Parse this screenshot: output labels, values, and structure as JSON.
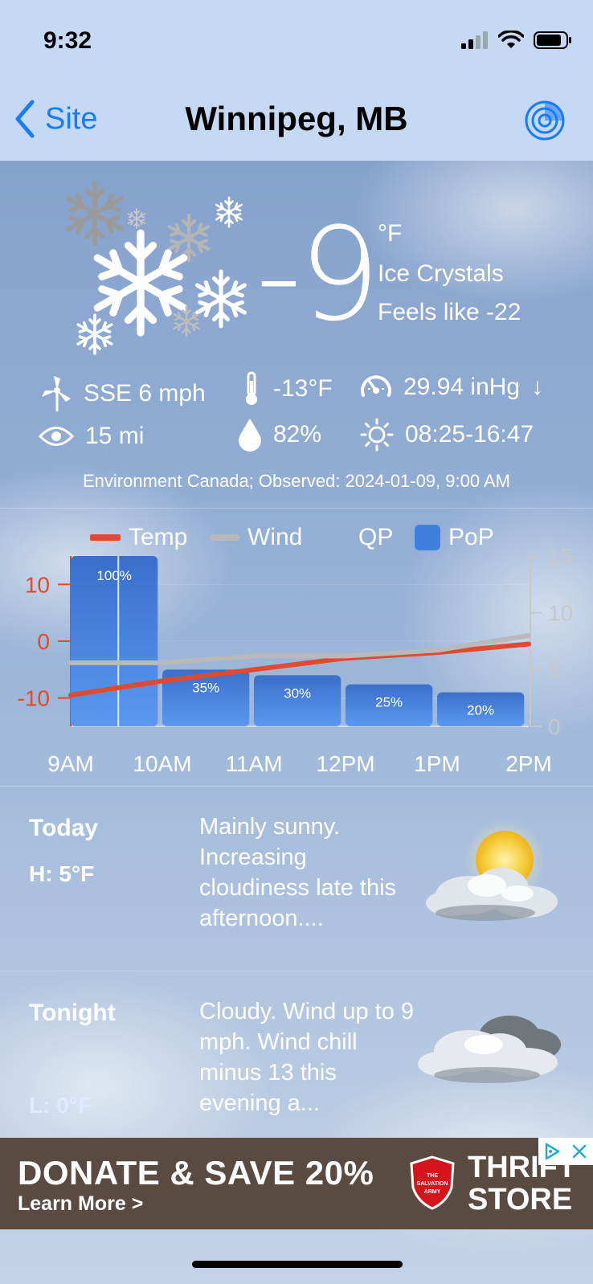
{
  "status_bar": {
    "time": "9:32"
  },
  "nav": {
    "back_label": "Site",
    "title": "Winnipeg, MB"
  },
  "current": {
    "temperature": "-9",
    "unit": "°F",
    "condition": "Ice Crystals",
    "feels_like": "Feels like -22"
  },
  "stats": {
    "wind": "SSE 6 mph",
    "dewpoint": "-13°F",
    "pressure": "29.94 inHg",
    "pressure_trend": "↓",
    "visibility": "15 mi",
    "humidity": "82%",
    "sun": "08:25-16:47"
  },
  "source": "Environment Canada; Observed: 2024-01-09, 9:00 AM",
  "legend": {
    "temp": "Temp",
    "wind": "Wind",
    "qp": "QP",
    "pop": "PoP"
  },
  "colors": {
    "temp": "#e04a2f",
    "wind": "#b9b9b9",
    "pop": "#3f7fe0",
    "left_axis": "#e04a2f",
    "right_axis": "#c8c8c8"
  },
  "chart_data": {
    "type": "bar",
    "x": [
      "9AM",
      "10AM",
      "11AM",
      "12PM",
      "1PM",
      "2PM"
    ],
    "pop_bars": [
      {
        "start": 0,
        "end": 0.95,
        "value": 15,
        "label": "100%"
      },
      {
        "start": 1,
        "end": 1.95,
        "value": 5,
        "label": "35%"
      },
      {
        "start": 2,
        "end": 2.95,
        "value": 4.5,
        "label": "30%"
      },
      {
        "start": 3,
        "end": 3.95,
        "value": 3.7,
        "label": "25%"
      },
      {
        "start": 4,
        "end": 4.95,
        "value": 3,
        "label": "20%"
      }
    ],
    "series": [
      {
        "name": "Temp",
        "axis": "left",
        "x": [
          0,
          1,
          2,
          3,
          4,
          5
        ],
        "values": [
          -9.5,
          -7,
          -5,
          -3,
          -2,
          -0.5
        ]
      },
      {
        "name": "Wind",
        "axis": "right",
        "x": [
          0,
          1,
          2,
          3,
          4,
          5
        ],
        "values": [
          5.6,
          5.6,
          6.2,
          6.2,
          6.7,
          8
        ]
      }
    ],
    "left_ticks": [
      "10",
      "0",
      "-10"
    ],
    "left_ylim": [
      -15,
      15
    ],
    "right_ticks": [
      "15",
      "10",
      "5",
      "0"
    ],
    "right_ylim": [
      0,
      15
    ]
  },
  "forecast": [
    {
      "period": "Today",
      "hilo": "H: 5°F",
      "text": "Mainly sunny. Increasing cloudiness late this afternoon...."
    },
    {
      "period": "Tonight",
      "hilo": "L: 0°F",
      "text": "Cloudy. Wind up to 9 mph. Wind chill minus 13 this evening a..."
    }
  ],
  "ad": {
    "headline": "DONATE & SAVE 20%",
    "cta": "Learn More >",
    "brand_line1": "THRIFT",
    "brand_line2": "STORE",
    "logo_text": "THE SALVATION ARMY"
  }
}
